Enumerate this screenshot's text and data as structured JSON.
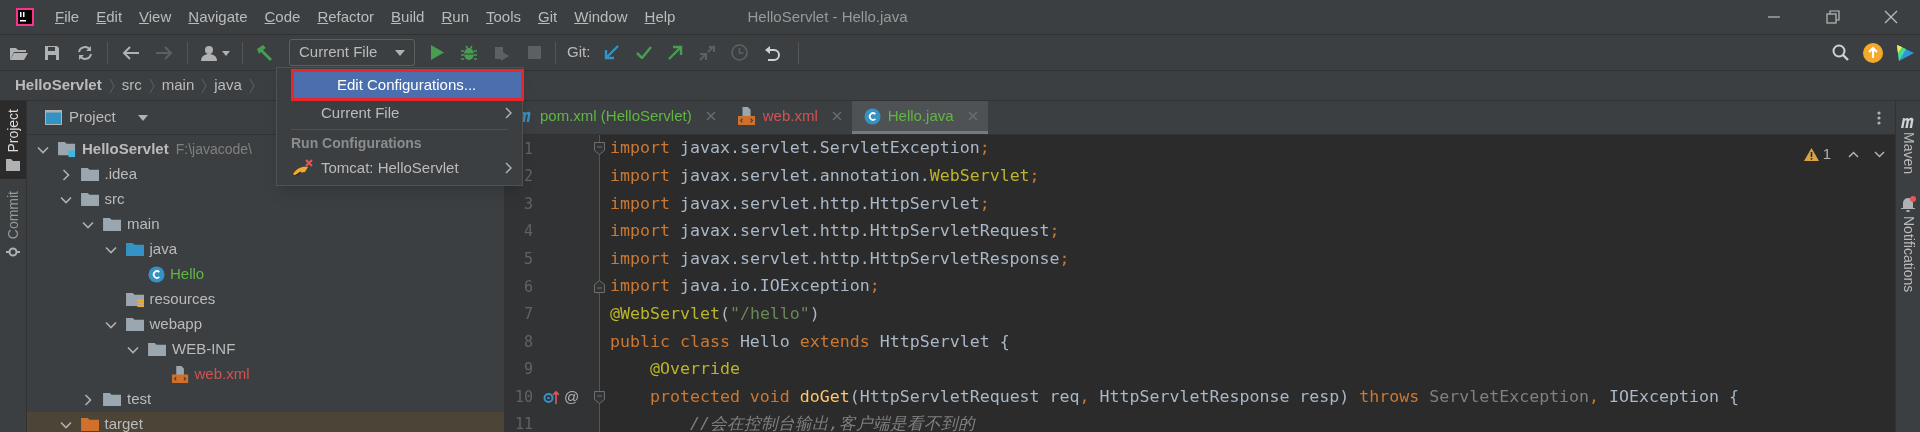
{
  "menu": [
    "File",
    "Edit",
    "View",
    "Navigate",
    "Code",
    "Refactor",
    "Build",
    "Run",
    "Tools",
    "Git",
    "Window",
    "Help"
  ],
  "window": {
    "title": "HelloServlet - Hello.java"
  },
  "toolbar": {
    "run_config": "Current File",
    "git_label": "Git:"
  },
  "breadcrumb": [
    "HelloServlet",
    "src",
    "main",
    "java"
  ],
  "left_stripe": [
    {
      "label": "Project",
      "selected": true
    },
    {
      "label": "Commit",
      "selected": false
    }
  ],
  "right_stripe": [
    {
      "label": "Maven",
      "kind": "maven"
    },
    {
      "label": "Notifications",
      "kind": "notifications"
    }
  ],
  "project_panel": {
    "title": "Project",
    "tree": [
      {
        "label": "HelloServlet",
        "hint": "F:\\javacode\\",
        "kind": "module",
        "expanded": true,
        "selected": false,
        "children": [
          {
            "label": ".idea",
            "kind": "folder",
            "expanded": false,
            "selected": false
          },
          {
            "label": "src",
            "kind": "folder",
            "expanded": true,
            "selected": false,
            "children": [
              {
                "label": "main",
                "kind": "folder",
                "expanded": true,
                "selected": false,
                "children": [
                  {
                    "label": "java",
                    "kind": "source-folder",
                    "expanded": true,
                    "selected": false,
                    "children": [
                      {
                        "label": "Hello",
                        "kind": "class",
                        "color": "#62b543",
                        "selected": false
                      }
                    ]
                  },
                  {
                    "label": "resources",
                    "kind": "resources-folder",
                    "selected": false
                  },
                  {
                    "label": "webapp",
                    "kind": "folder",
                    "expanded": true,
                    "selected": false,
                    "children": [
                      {
                        "label": "WEB-INF",
                        "kind": "folder",
                        "expanded": true,
                        "selected": false,
                        "children": [
                          {
                            "label": "web.xml",
                            "kind": "xml-file",
                            "color": "#d25252",
                            "selected": false
                          }
                        ]
                      }
                    ]
                  }
                ]
              },
              {
                "label": "test",
                "kind": "folder",
                "expanded": false,
                "selected": false
              }
            ]
          },
          {
            "label": "target",
            "kind": "excluded-folder",
            "expanded": true,
            "selected": true
          }
        ]
      }
    ]
  },
  "editor_tabs": [
    {
      "label": "pom.xml (HelloServlet)",
      "kind": "maven",
      "color": "#62b543",
      "selected": false
    },
    {
      "label": "web.xml",
      "kind": "xml",
      "color": "#d25252",
      "selected": false
    },
    {
      "label": "Hello.java",
      "kind": "class",
      "color": "#62b543",
      "selected": true
    }
  ],
  "inspections": {
    "warnings": "1"
  },
  "code": [
    {
      "number": "1",
      "fold_start": true,
      "tokens": [
        {
          "kind": "keyword",
          "text": "import"
        },
        {
          "kind": "plain",
          "text": " javax.servlet.ServletException"
        },
        {
          "kind": "punct",
          "text": ";"
        }
      ]
    },
    {
      "number": "2",
      "tokens": [
        {
          "kind": "keyword",
          "text": "import"
        },
        {
          "kind": "plain",
          "text": " javax.servlet.annotation."
        },
        {
          "kind": "annotation",
          "text": "WebServlet"
        },
        {
          "kind": "punct",
          "text": ";"
        }
      ]
    },
    {
      "number": "3",
      "tokens": [
        {
          "kind": "keyword",
          "text": "import"
        },
        {
          "kind": "plain",
          "text": " javax.servlet.http.HttpServlet"
        },
        {
          "kind": "punct",
          "text": ";"
        }
      ]
    },
    {
      "number": "4",
      "tokens": [
        {
          "kind": "keyword",
          "text": "import"
        },
        {
          "kind": "plain",
          "text": " javax.servlet.http.HttpServletRequest"
        },
        {
          "kind": "punct",
          "text": ";"
        }
      ]
    },
    {
      "number": "5",
      "tokens": [
        {
          "kind": "keyword",
          "text": "import"
        },
        {
          "kind": "plain",
          "text": " javax.servlet.http.HttpServletResponse"
        },
        {
          "kind": "punct",
          "text": ";"
        }
      ]
    },
    {
      "number": "6",
      "fold_end": true,
      "tokens": [
        {
          "kind": "keyword",
          "text": "import"
        },
        {
          "kind": "plain",
          "text": " java.io.IOException"
        },
        {
          "kind": "punct",
          "text": ";"
        }
      ]
    },
    {
      "number": "7",
      "tokens": [
        {
          "kind": "annotation",
          "text": "@WebServlet"
        },
        {
          "kind": "plain",
          "text": "("
        },
        {
          "kind": "string",
          "text": "\"/hello\""
        },
        {
          "kind": "plain",
          "text": ")"
        }
      ]
    },
    {
      "number": "8",
      "tokens": [
        {
          "kind": "keyword",
          "text": "public class"
        },
        {
          "kind": "plain",
          "text": " Hello "
        },
        {
          "kind": "keyword",
          "text": "extends"
        },
        {
          "kind": "plain",
          "text": " HttpServlet {"
        }
      ]
    },
    {
      "number": "9",
      "tokens": [
        {
          "kind": "annotation",
          "text": "    @Override"
        }
      ]
    },
    {
      "number": "10",
      "fold_start": true,
      "override": true,
      "mark": "@",
      "tokens": [
        {
          "kind": "keyword",
          "text": "    protected void"
        },
        {
          "kind": "method",
          "text": " doGet"
        },
        {
          "kind": "plain",
          "text": "(HttpServletRequest req"
        },
        {
          "kind": "punct",
          "text": ","
        },
        {
          "kind": "plain",
          "text": " HttpServletResponse resp) "
        },
        {
          "kind": "keyword",
          "text": "throws "
        },
        {
          "kind": "unused",
          "text": "ServletException"
        },
        {
          "kind": "punct",
          "text": ","
        },
        {
          "kind": "plain",
          "text": " IOException {"
        }
      ]
    },
    {
      "number": "11",
      "tokens": [
        {
          "kind": "comment",
          "text": "        //会在控制台输出,客户端是看不到的"
        }
      ]
    }
  ],
  "popup": [
    {
      "label": "Edit Configurations...",
      "kind": "action",
      "selected": true,
      "outlined": true
    },
    {
      "label": "Current File",
      "kind": "submenu",
      "selected": false,
      "outlined": false
    },
    {
      "label": "Run Configurations",
      "kind": "header"
    },
    {
      "label": "Tomcat: HelloServlet",
      "kind": "run-config",
      "selected": false,
      "outlined": false
    }
  ]
}
